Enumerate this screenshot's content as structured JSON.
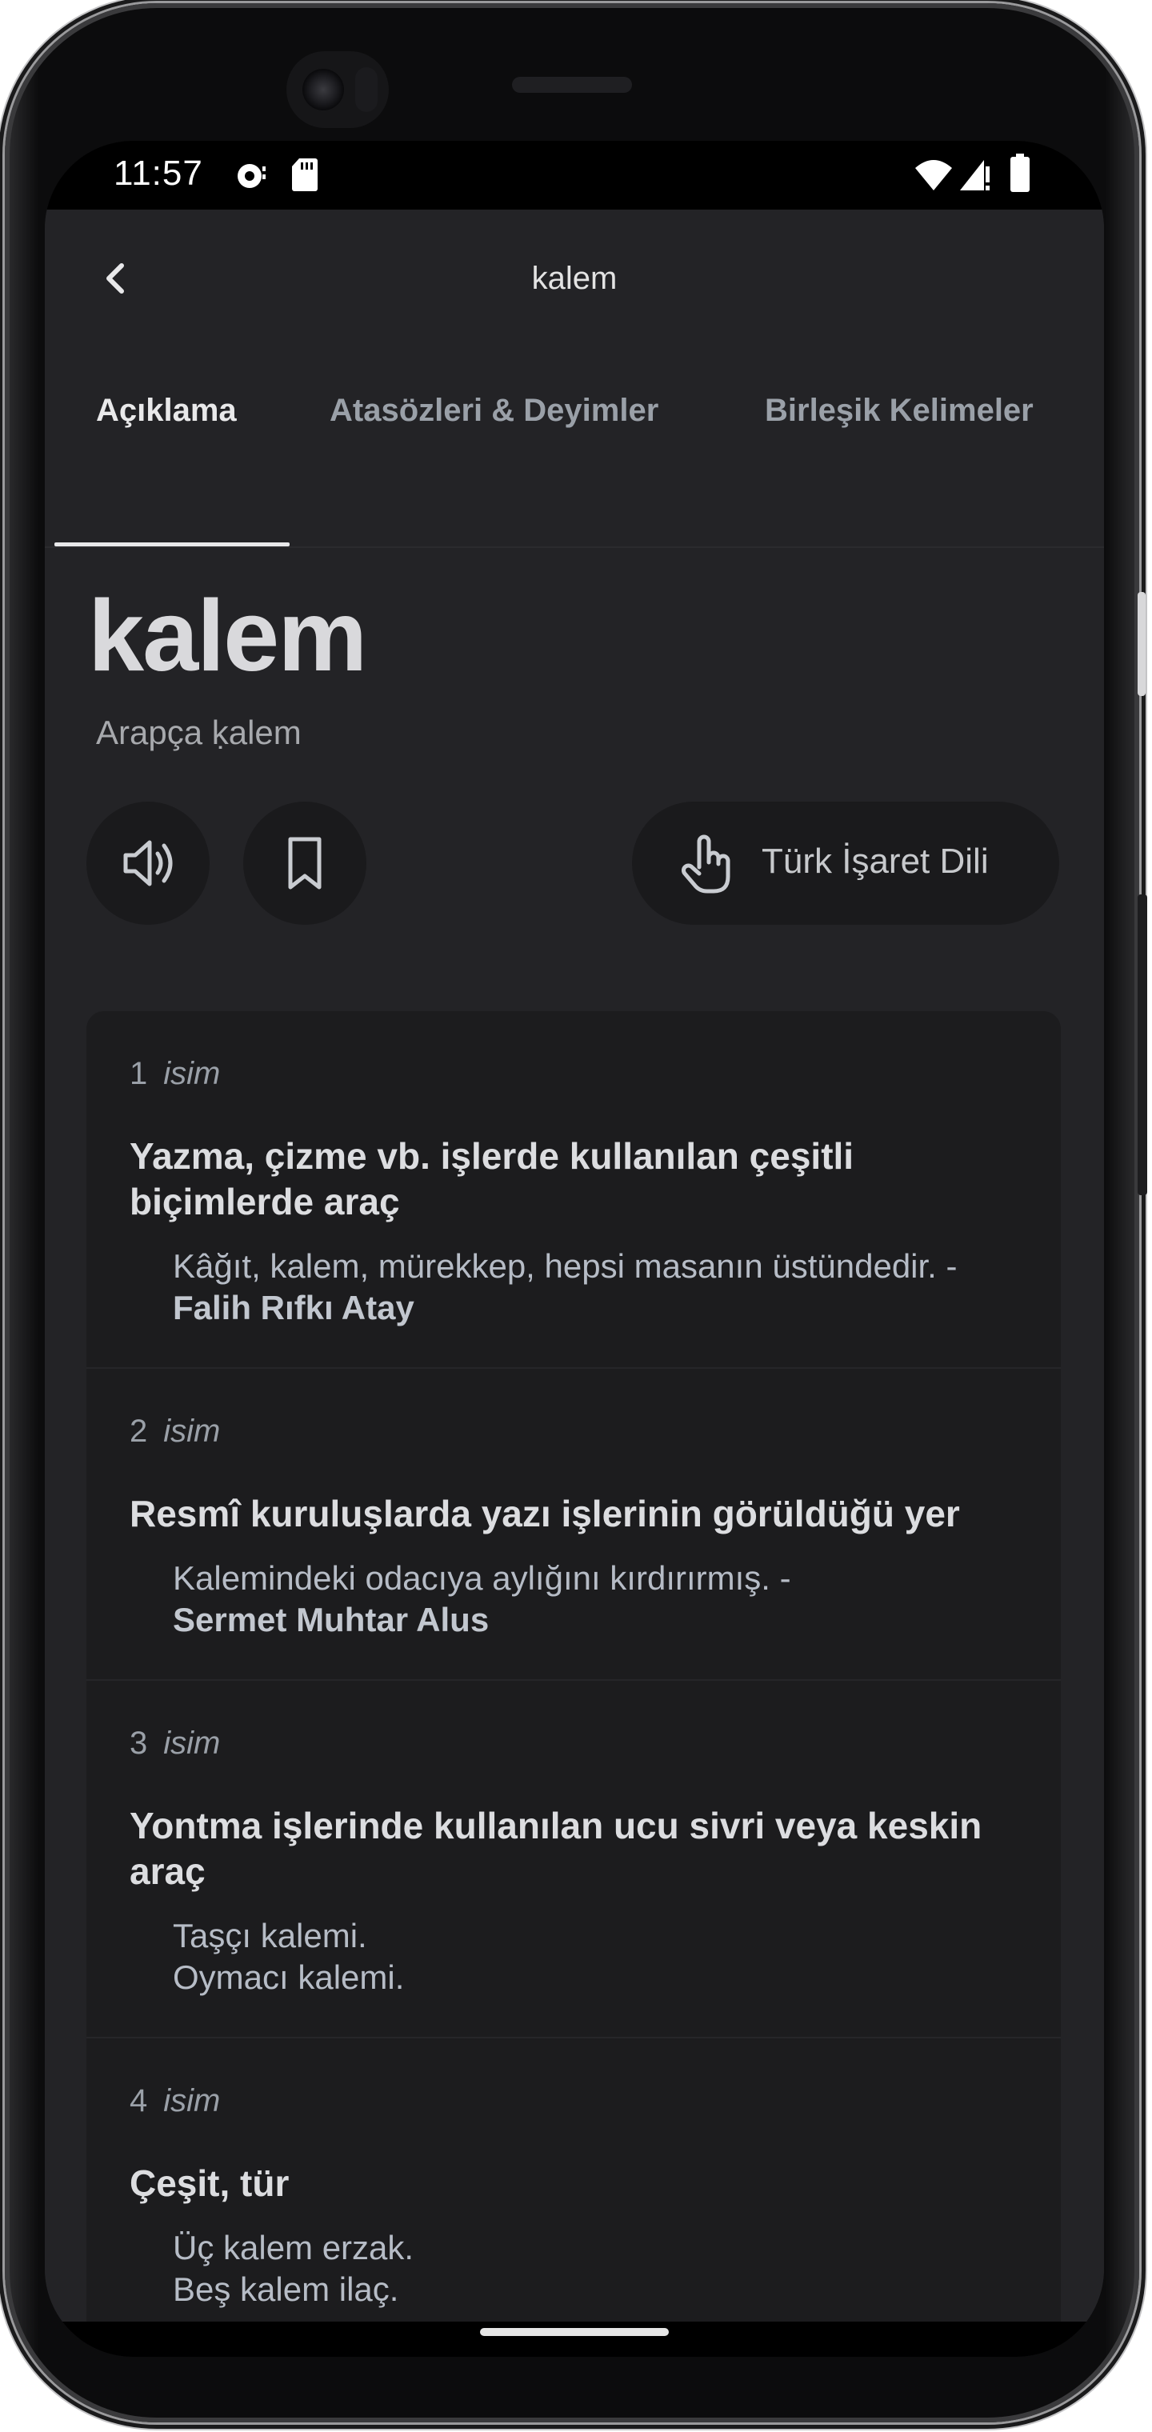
{
  "status_bar": {
    "time": "11:57",
    "left_icons": [
      "podcast-icon",
      "sd-card-icon"
    ],
    "right_icons": [
      "wifi-icon",
      "cell-signal-icon",
      "battery-icon"
    ]
  },
  "app_bar": {
    "back_icon": "chevron-left-icon",
    "title": "kalem"
  },
  "tabs": [
    {
      "label": "Açıklama",
      "active": true
    },
    {
      "label": "Atasözleri & Deyimler",
      "active": false
    },
    {
      "label": "Birleşik Kelimeler",
      "active": false
    }
  ],
  "entry": {
    "word": "kalem",
    "origin": "Arapça ḳalem"
  },
  "actions": {
    "speaker_icon": "speaker-icon",
    "bookmark_icon": "bookmark-icon",
    "sign_language_icon": "hand-pointer-icon",
    "sign_language_label": "Türk İşaret Dili"
  },
  "meanings": [
    {
      "number": "1",
      "pos": "isim",
      "definition": "Yazma, çizme vb. işlerde kullanılan çeşitli biçimlerde araç",
      "example": "Kâğıt, kalem, mürekkep, hepsi masanın üstündedir. - ",
      "author": "Falih Rıfkı Atay"
    },
    {
      "number": "2",
      "pos": "isim",
      "definition": "Resmî kuruluşlarda yazı işlerinin görüldüğü yer",
      "example": "Kalemindeki odacıya aylığını kırdırırmış. - ",
      "author": "Sermet Muhtar Alus"
    },
    {
      "number": "3",
      "pos": "isim",
      "definition": "Yontma işlerinde kullanılan ucu sivri veya keskin araç",
      "example": "Taşçı kalemi.",
      "example2": "Oymacı kalemi."
    },
    {
      "number": "4",
      "pos": "isim",
      "definition": "Çeşit, tür",
      "example": "Üç kalem erzak.",
      "example2": "Beş kalem ilaç."
    }
  ],
  "colors": {
    "background": "#232326",
    "card": "#1c1c1e",
    "button": "#1a1a1c",
    "text_primary": "#dcdde0",
    "text_secondary": "#9aa0a8"
  }
}
